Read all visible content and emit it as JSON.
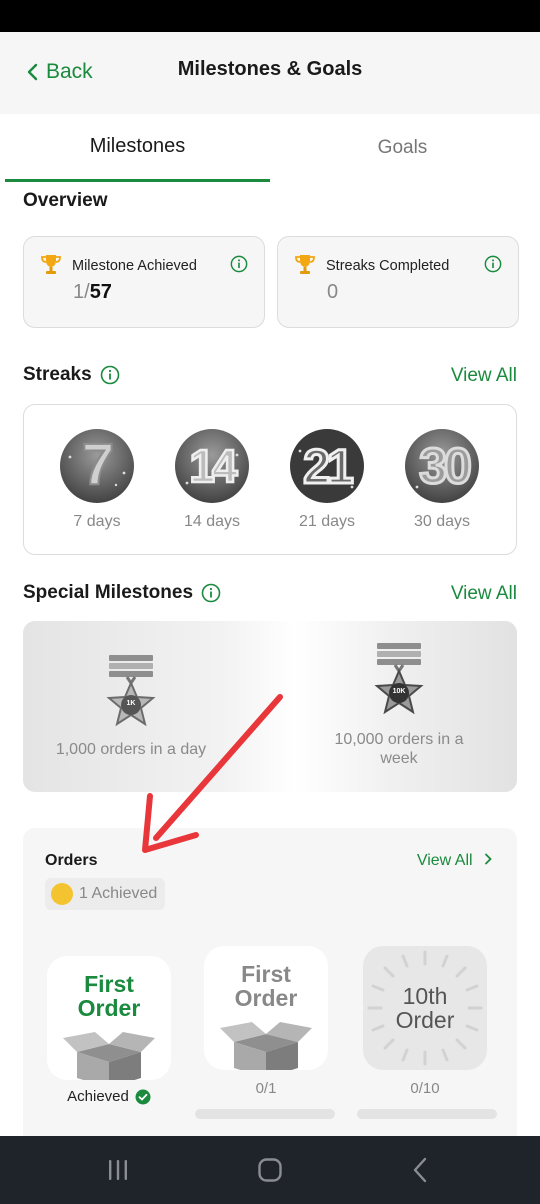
{
  "header": {
    "back_label": "Back",
    "title": "Milestones & Goals"
  },
  "tabs": [
    {
      "label": "Milestones",
      "active": true
    },
    {
      "label": "Goals",
      "active": false
    }
  ],
  "overview": {
    "title": "Overview",
    "cards": [
      {
        "label": "Milestone Achieved",
        "value_done": "1",
        "value_total": "57"
      },
      {
        "label": "Streaks Completed",
        "value": "0"
      }
    ]
  },
  "streaks": {
    "title": "Streaks",
    "view_all": "View All",
    "items": [
      {
        "number": "7",
        "label": "7 days"
      },
      {
        "number": "14",
        "label": "14 days"
      },
      {
        "number": "21",
        "label": "21 days"
      },
      {
        "number": "30",
        "label": "30 days"
      }
    ]
  },
  "special": {
    "title": "Special Milestones",
    "view_all": "View All",
    "items": [
      {
        "badge_text": "1K",
        "label": "1,000 orders in a day"
      },
      {
        "badge_text": "10K",
        "label": "10,000 orders in a week"
      }
    ]
  },
  "orders": {
    "title": "Orders",
    "view_all": "View All",
    "achieved_chip": "1 Achieved",
    "items": [
      {
        "line1": "First",
        "line2": "Order",
        "status": "Achieved",
        "achieved": true
      },
      {
        "line1": "First",
        "line2": "Order",
        "status": "0/1",
        "achieved": false
      },
      {
        "line1": "10th",
        "line2": "Order",
        "status": "0/10",
        "achieved": false
      }
    ]
  },
  "colors": {
    "accent": "#1a8a3e",
    "annotation_arrow": "#e8363a"
  },
  "icons": [
    "chevron-left-icon",
    "info-icon",
    "trophy-icon",
    "check-badge-icon",
    "chevron-right-icon",
    "recents-icon",
    "home-icon",
    "back-nav-icon"
  ]
}
